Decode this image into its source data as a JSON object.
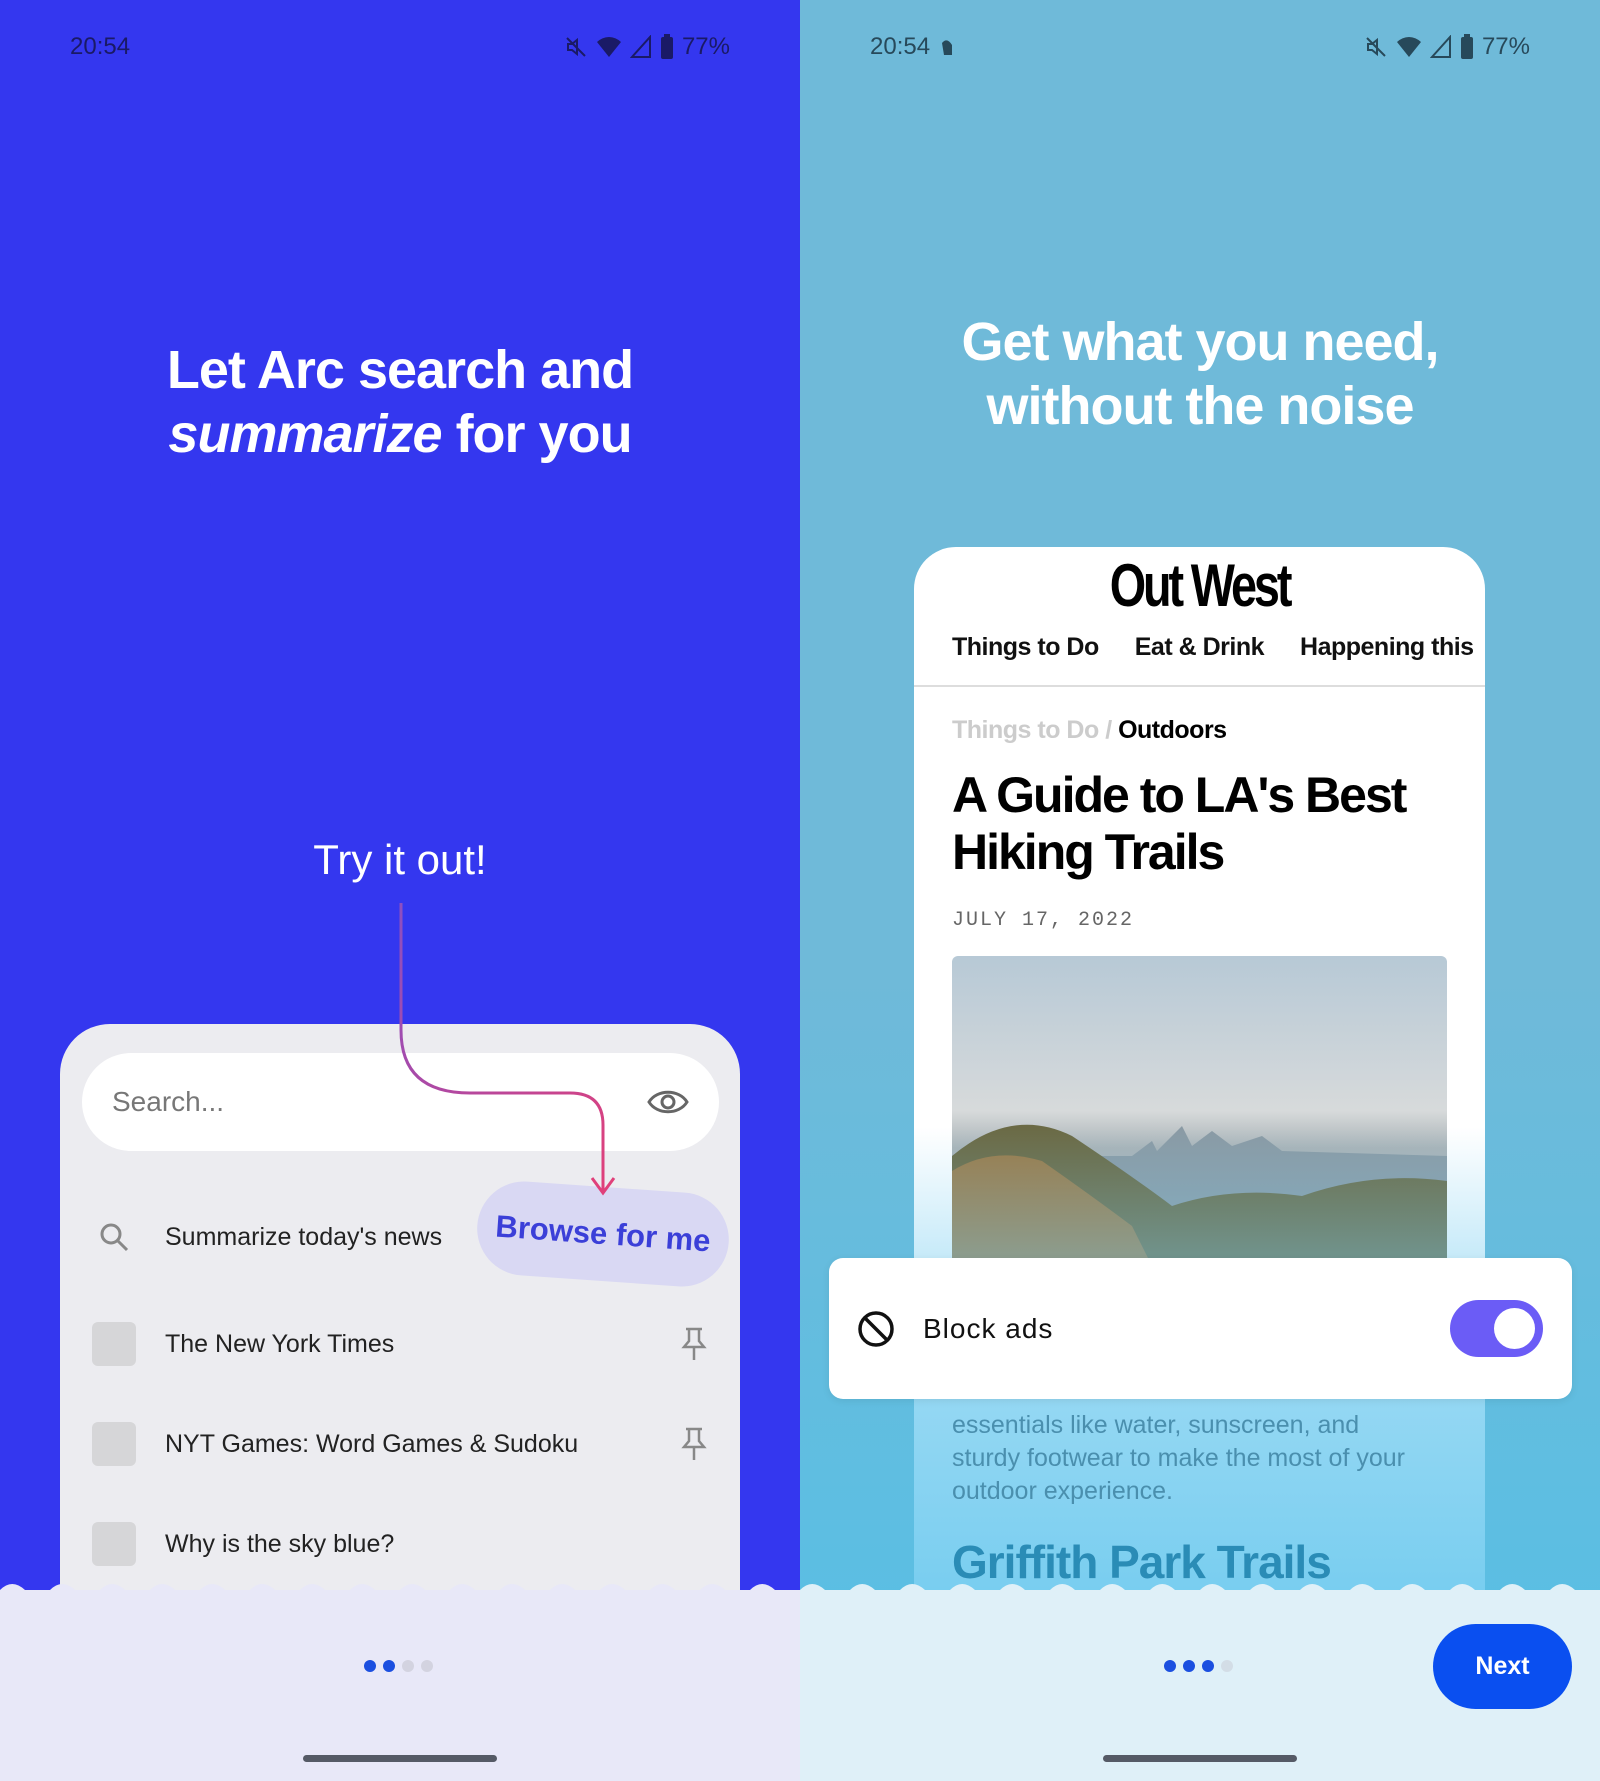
{
  "left": {
    "status": {
      "time": "20:54",
      "battery": "77%"
    },
    "title_line1": "Let Arc search and",
    "title_em": "summarize",
    "title_rest": " for you",
    "try_label": "Try it out!",
    "search": {
      "placeholder": "Search..."
    },
    "browse_label": "Browse for me",
    "rows": [
      {
        "label": "Summarize today's news",
        "icon": "search-icon"
      },
      {
        "label": "The New York Times",
        "icon": "pin-icon"
      },
      {
        "label": "NYT Games: Word Games & Sudoku",
        "icon": "pin-icon"
      },
      {
        "label": "Why is the sky blue?"
      }
    ],
    "page_indicator": {
      "total": 4,
      "current": 2
    }
  },
  "right": {
    "status": {
      "time": "20:54",
      "battery": "77%"
    },
    "title_line1": "Get what you need,",
    "title_line2": "without the noise",
    "site": {
      "logo": "Out West",
      "nav": [
        "Things to Do",
        "Eat & Drink",
        "Happening this"
      ],
      "crumb_parent": "Things to Do /",
      "crumb_current": "Outdoors",
      "headline_1": "A Guide to LA's Best",
      "headline_2": "Hiking Trails",
      "date": "JULY 17, 2022",
      "body": [
        "essentials like water, sunscreen, and",
        "sturdy footwear to make the most of your",
        "outdoor experience."
      ],
      "subhead": "Griffith Park Trails"
    },
    "block_ads": {
      "label": "Block ads",
      "enabled": true
    },
    "next_label": "Next",
    "page_indicator": {
      "total": 4,
      "current": 3
    }
  },
  "colors": {
    "left_bg": "#3437ef",
    "right_bg": "#6fbad9",
    "accent": "#0a4ff0",
    "toggle": "#6b5cf6"
  }
}
